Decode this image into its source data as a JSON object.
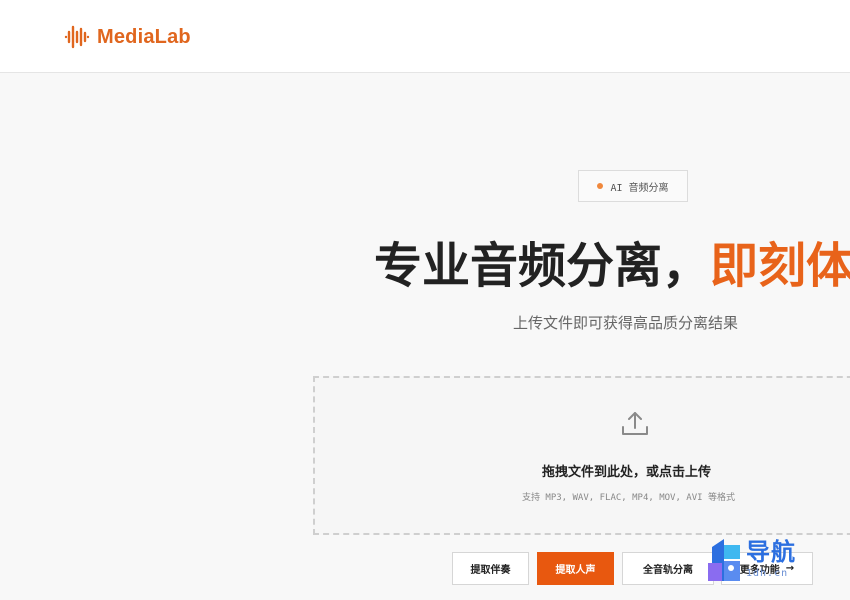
{
  "header": {
    "brand": "MediaLab",
    "brand_color": "#e0661e",
    "logo_icon": "sound-wave-icon"
  },
  "hero": {
    "badge": "AI 音频分离",
    "title_main": "专业音频分离，",
    "title_accent": "即刻体",
    "accent_color": "#e8631a",
    "subtitle": "上传文件即可获得高品质分离结果"
  },
  "upload": {
    "icon": "upload-icon",
    "title": "拖拽文件到此处，或点击上传",
    "formats": "支持 MP3, WAV, FLAC, MP4, MOV, AVI 等格式"
  },
  "actions": {
    "accompaniment": "提取伴奏",
    "vocals": "提取人声",
    "all_tracks": "全音轨分离",
    "more": "更多功能",
    "more_icon": "arrow-right-icon",
    "primary_color": "#e8580f"
  },
  "watermark": {
    "title": "导航",
    "subtitle": "1dh.cn",
    "color": "#2c6fe0"
  }
}
